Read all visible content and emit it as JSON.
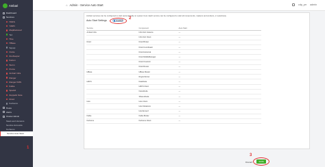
{
  "app": {
    "name": "Ambari"
  },
  "header": {
    "page_title": "Admin - Service Auto Start",
    "cluster": "cdp_prr",
    "user": "admin"
  },
  "sidebar": {
    "items": [
      {
        "label": "Dashboard",
        "kind": "section",
        "status": "glyph"
      },
      {
        "label": "Services",
        "kind": "section",
        "status": "glyph"
      },
      {
        "label": "HDFS",
        "kind": "sub",
        "status": "red"
      },
      {
        "label": "YARN",
        "kind": "sub",
        "status": "red"
      },
      {
        "label": "MapReduce2",
        "kind": "sub",
        "status": "red"
      },
      {
        "label": "Tez",
        "kind": "sub",
        "status": "green"
      },
      {
        "label": "Hive",
        "kind": "sub",
        "status": "red"
      },
      {
        "label": "HBase",
        "kind": "sub",
        "status": "red"
      },
      {
        "label": "Sqoop",
        "kind": "sub",
        "status": "grey"
      },
      {
        "label": "Oozie",
        "kind": "sub",
        "status": "red"
      },
      {
        "label": "ZooKeeper",
        "kind": "sub",
        "status": "red"
      },
      {
        "label": "Falcon",
        "kind": "sub",
        "status": "red"
      },
      {
        "label": "Storm",
        "kind": "sub",
        "status": "red"
      },
      {
        "label": "Flume",
        "kind": "sub",
        "status": "red"
      },
      {
        "label": "Ambari Infra",
        "kind": "sub",
        "status": "red"
      },
      {
        "label": "Ranger",
        "kind": "sub",
        "status": "red"
      },
      {
        "label": "Ranger KMS",
        "kind": "sub",
        "status": "red"
      },
      {
        "label": "Kafka",
        "kind": "sub",
        "status": "red"
      },
      {
        "label": "Spark2",
        "kind": "sub",
        "status": "red"
      },
      {
        "label": "Zeppelin Note",
        "kind": "sub",
        "status": "red"
      },
      {
        "label": "Druid",
        "kind": "sub",
        "status": "red"
      },
      {
        "label": "Kerberos",
        "kind": "sub",
        "status": "grey"
      },
      {
        "label": "Hosts",
        "kind": "section",
        "status": "glyph"
      },
      {
        "label": "Alerts",
        "kind": "section",
        "status": "glyph"
      },
      {
        "label": "Cluster Admin",
        "kind": "section",
        "status": "glyph"
      },
      {
        "label": "Stack and Versions",
        "kind": "sub",
        "status": "none"
      },
      {
        "label": "Service Accounts",
        "kind": "sub",
        "status": "none"
      },
      {
        "label": "Kerberos",
        "kind": "sub",
        "status": "none"
      },
      {
        "label": "Service Auto Start",
        "kind": "sub",
        "status": "none",
        "active": true
      }
    ]
  },
  "markers": {
    "step1": "1",
    "step2": "2",
    "step3": "3"
  },
  "content": {
    "intro": "Ambari services can be configured to start automatically on system boot. Each service can be configured to start all components, masters and workers, or selectively.",
    "section_title": "Auto Start Settings",
    "toggle_label": "Enabled",
    "table": {
      "headers": [
        "Service",
        "Component",
        "Auto Start"
      ],
      "rows": [
        {
          "service": "Ambari Infra",
          "component": "Infra Solr Instance",
          "auto": "—"
        },
        {
          "service": "",
          "component": "Infra Solr Client",
          "auto": "—"
        },
        {
          "service": "Druid",
          "component": "Druid Broker",
          "auto": "—"
        },
        {
          "service": "",
          "component": "Druid Coordinator",
          "auto": "—"
        },
        {
          "service": "",
          "component": "Druid Historical",
          "auto": "—"
        },
        {
          "service": "",
          "component": "Druid MiddleManager",
          "auto": "—"
        },
        {
          "service": "",
          "component": "Druid Overlord",
          "auto": "—"
        },
        {
          "service": "",
          "component": "Druid Router",
          "auto": "—"
        },
        {
          "service": "HBase",
          "component": "HBase Master",
          "auto": "—"
        },
        {
          "service": "",
          "component": "RegionServer",
          "auto": "—"
        },
        {
          "service": "HDFS",
          "component": "DataNode",
          "auto": "—"
        },
        {
          "service": "",
          "component": "HDFS Client",
          "auto": "—"
        },
        {
          "service": "",
          "component": "NameNode",
          "auto": "—"
        },
        {
          "service": "",
          "component": "SNameNode",
          "auto": "—"
        },
        {
          "service": "Hive",
          "component": "Hive Client",
          "auto": "—"
        },
        {
          "service": "",
          "component": "Hive Metastore",
          "auto": "—"
        },
        {
          "service": "",
          "component": "HiveServer2",
          "auto": "—"
        },
        {
          "service": "Kafka",
          "component": "Kafka Broker",
          "auto": "—"
        },
        {
          "service": "Kerberos",
          "component": "Kerberos Client",
          "auto": "—"
        }
      ]
    }
  },
  "footer": {
    "discard_label": "Discard",
    "save_label": "SAVE"
  }
}
